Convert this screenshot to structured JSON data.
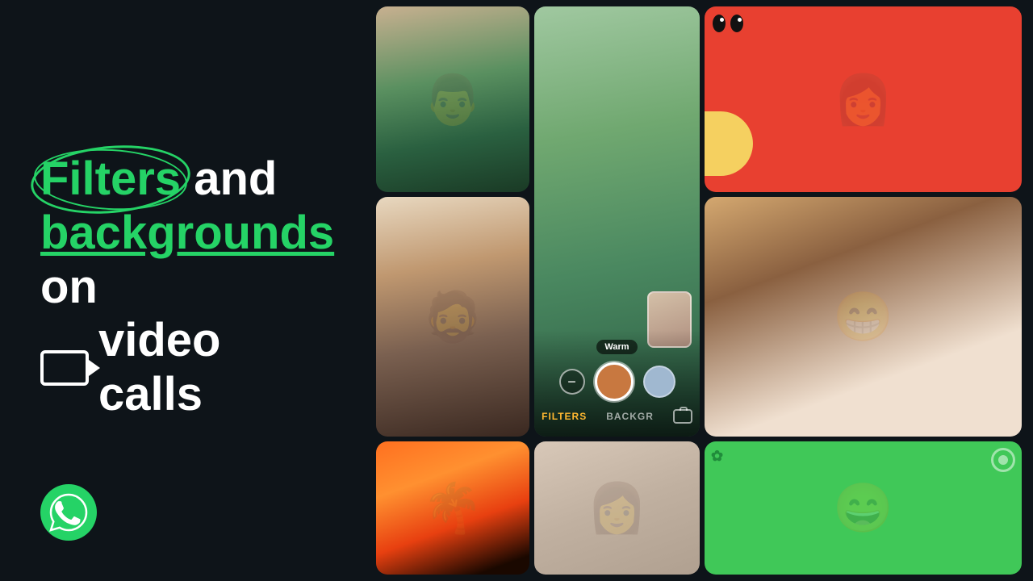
{
  "background_color": "#0e1419",
  "left": {
    "headline_part1": "Filters",
    "headline_and": "and",
    "headline_part2": "backgrounds",
    "headline_on": "on",
    "headline_video": "video calls",
    "video_icon_label": "video-camera"
  },
  "filter_ui": {
    "label": "Warm",
    "tab_filters": "FILTERS",
    "tab_backgr": "BACKGR",
    "minus_symbol": "−"
  },
  "brand": {
    "color_green": "#25d366",
    "color_white": "#ffffff",
    "color_dark": "#0e1419"
  }
}
